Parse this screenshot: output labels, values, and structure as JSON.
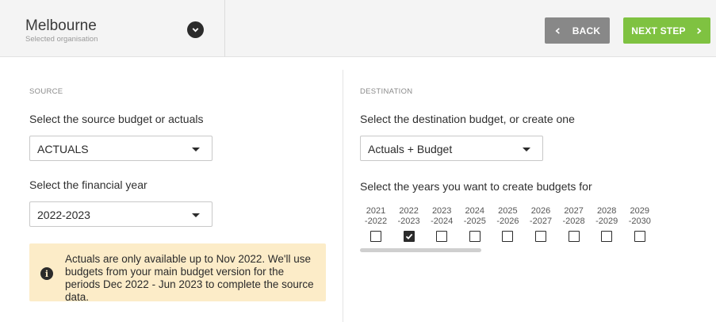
{
  "header": {
    "org_name": "Melbourne",
    "org_sub": "Selected organisation",
    "toggle_icon": "chevron-down-icon",
    "back_label": "BACK",
    "next_label": "NEXT STEP"
  },
  "source": {
    "section_label": "SOURCE",
    "budget_prompt": "Select the source budget or actuals",
    "budget_value": "ACTUALS",
    "year_prompt": "Select the financial year",
    "year_value": "2022-2023",
    "notice_icon": "info-icon",
    "notice_text": "Actuals are only available up to Nov 2022. We'll use budgets from your main budget version for the periods Dec 2022 - Jun 2023 to complete the source data."
  },
  "destination": {
    "section_label": "DESTINATION",
    "budget_prompt": "Select the destination budget, or create one",
    "budget_value": "Actuals + Budget",
    "years_prompt": "Select the years you want to create budgets for",
    "years": [
      {
        "line1": "2021",
        "line2": "-2022",
        "checked": false
      },
      {
        "line1": "2022",
        "line2": "-2023",
        "checked": true
      },
      {
        "line1": "2023",
        "line2": "-2024",
        "checked": false
      },
      {
        "line1": "2024",
        "line2": "-2025",
        "checked": false
      },
      {
        "line1": "2025",
        "line2": "-2026",
        "checked": false
      },
      {
        "line1": "2026",
        "line2": "-2027",
        "checked": false
      },
      {
        "line1": "2027",
        "line2": "-2028",
        "checked": false
      },
      {
        "line1": "2028",
        "line2": "-2029",
        "checked": false
      },
      {
        "line1": "2029",
        "line2": "-2030",
        "checked": false
      }
    ]
  },
  "colors": {
    "next_button": "#7fc241",
    "back_button": "#888888",
    "notice_bg": "#fcecc8"
  }
}
